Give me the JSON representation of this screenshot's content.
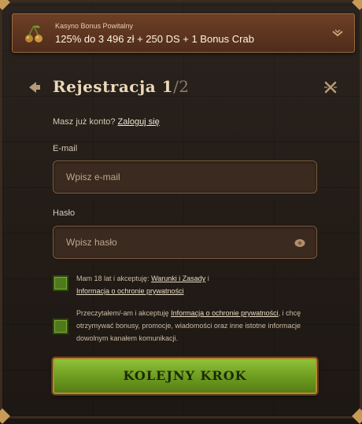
{
  "bonus": {
    "label": "Kasyno Bonus Powitalny",
    "text": "125% do 3 496 zł + 250 DS + 1 Bonus Crab"
  },
  "header": {
    "title_main": "Rejestracja 1",
    "title_step": "/2"
  },
  "login": {
    "prompt": "Masz już konto?",
    "link": "Zaloguj się"
  },
  "email": {
    "label": "E-mail",
    "placeholder": "Wpisz e-mail"
  },
  "password": {
    "label": "Hasło",
    "placeholder": "Wpisz hasło"
  },
  "consent_age": {
    "text_before": "Mam 18 lat i akceptuję:",
    "link_terms": "Warunki i Zasady",
    "text_mid": "i",
    "link_privacy": "Informacja o ochronie prywatności"
  },
  "consent_marketing": {
    "text_before": "Przeczytałem/-am i akceptuję",
    "link_privacy": "Informacja o ochronie prywatności",
    "text_after": ", i chcę otrzymywać bonusy, promocje, wiadomości oraz inne istotne informacje dowolnym kanałem komunikacji."
  },
  "submit": {
    "label": "KOLEJNY KROK"
  },
  "colors": {
    "accent_green": "#6c9b1f",
    "gold_border": "#b8892f",
    "banner_brown": "#6e3f26"
  }
}
